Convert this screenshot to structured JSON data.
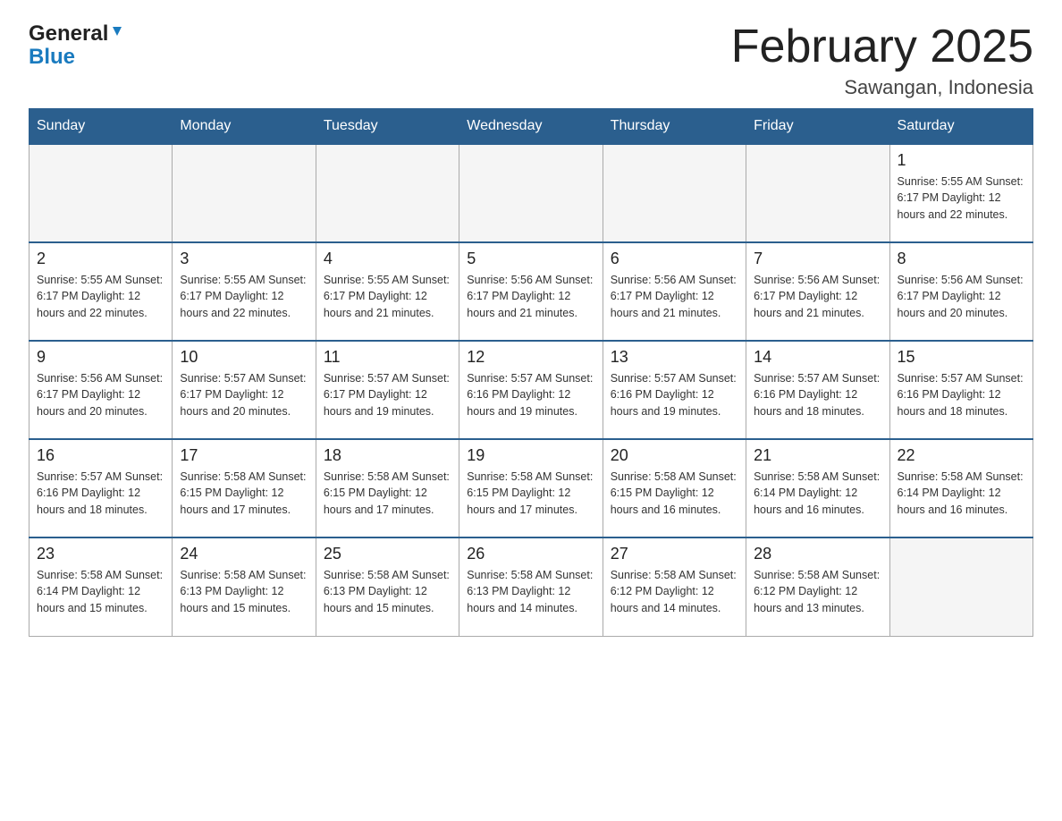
{
  "logo": {
    "general": "General",
    "blue": "Blue"
  },
  "header": {
    "month_title": "February 2025",
    "location": "Sawangan, Indonesia"
  },
  "weekdays": [
    "Sunday",
    "Monday",
    "Tuesday",
    "Wednesday",
    "Thursday",
    "Friday",
    "Saturday"
  ],
  "weeks": [
    {
      "days": [
        {
          "number": "",
          "info": "",
          "empty": true
        },
        {
          "number": "",
          "info": "",
          "empty": true
        },
        {
          "number": "",
          "info": "",
          "empty": true
        },
        {
          "number": "",
          "info": "",
          "empty": true
        },
        {
          "number": "",
          "info": "",
          "empty": true
        },
        {
          "number": "",
          "info": "",
          "empty": true
        },
        {
          "number": "1",
          "info": "Sunrise: 5:55 AM\nSunset: 6:17 PM\nDaylight: 12 hours\nand 22 minutes.",
          "empty": false
        }
      ]
    },
    {
      "days": [
        {
          "number": "2",
          "info": "Sunrise: 5:55 AM\nSunset: 6:17 PM\nDaylight: 12 hours\nand 22 minutes.",
          "empty": false
        },
        {
          "number": "3",
          "info": "Sunrise: 5:55 AM\nSunset: 6:17 PM\nDaylight: 12 hours\nand 22 minutes.",
          "empty": false
        },
        {
          "number": "4",
          "info": "Sunrise: 5:55 AM\nSunset: 6:17 PM\nDaylight: 12 hours\nand 21 minutes.",
          "empty": false
        },
        {
          "number": "5",
          "info": "Sunrise: 5:56 AM\nSunset: 6:17 PM\nDaylight: 12 hours\nand 21 minutes.",
          "empty": false
        },
        {
          "number": "6",
          "info": "Sunrise: 5:56 AM\nSunset: 6:17 PM\nDaylight: 12 hours\nand 21 minutes.",
          "empty": false
        },
        {
          "number": "7",
          "info": "Sunrise: 5:56 AM\nSunset: 6:17 PM\nDaylight: 12 hours\nand 21 minutes.",
          "empty": false
        },
        {
          "number": "8",
          "info": "Sunrise: 5:56 AM\nSunset: 6:17 PM\nDaylight: 12 hours\nand 20 minutes.",
          "empty": false
        }
      ]
    },
    {
      "days": [
        {
          "number": "9",
          "info": "Sunrise: 5:56 AM\nSunset: 6:17 PM\nDaylight: 12 hours\nand 20 minutes.",
          "empty": false
        },
        {
          "number": "10",
          "info": "Sunrise: 5:57 AM\nSunset: 6:17 PM\nDaylight: 12 hours\nand 20 minutes.",
          "empty": false
        },
        {
          "number": "11",
          "info": "Sunrise: 5:57 AM\nSunset: 6:17 PM\nDaylight: 12 hours\nand 19 minutes.",
          "empty": false
        },
        {
          "number": "12",
          "info": "Sunrise: 5:57 AM\nSunset: 6:16 PM\nDaylight: 12 hours\nand 19 minutes.",
          "empty": false
        },
        {
          "number": "13",
          "info": "Sunrise: 5:57 AM\nSunset: 6:16 PM\nDaylight: 12 hours\nand 19 minutes.",
          "empty": false
        },
        {
          "number": "14",
          "info": "Sunrise: 5:57 AM\nSunset: 6:16 PM\nDaylight: 12 hours\nand 18 minutes.",
          "empty": false
        },
        {
          "number": "15",
          "info": "Sunrise: 5:57 AM\nSunset: 6:16 PM\nDaylight: 12 hours\nand 18 minutes.",
          "empty": false
        }
      ]
    },
    {
      "days": [
        {
          "number": "16",
          "info": "Sunrise: 5:57 AM\nSunset: 6:16 PM\nDaylight: 12 hours\nand 18 minutes.",
          "empty": false
        },
        {
          "number": "17",
          "info": "Sunrise: 5:58 AM\nSunset: 6:15 PM\nDaylight: 12 hours\nand 17 minutes.",
          "empty": false
        },
        {
          "number": "18",
          "info": "Sunrise: 5:58 AM\nSunset: 6:15 PM\nDaylight: 12 hours\nand 17 minutes.",
          "empty": false
        },
        {
          "number": "19",
          "info": "Sunrise: 5:58 AM\nSunset: 6:15 PM\nDaylight: 12 hours\nand 17 minutes.",
          "empty": false
        },
        {
          "number": "20",
          "info": "Sunrise: 5:58 AM\nSunset: 6:15 PM\nDaylight: 12 hours\nand 16 minutes.",
          "empty": false
        },
        {
          "number": "21",
          "info": "Sunrise: 5:58 AM\nSunset: 6:14 PM\nDaylight: 12 hours\nand 16 minutes.",
          "empty": false
        },
        {
          "number": "22",
          "info": "Sunrise: 5:58 AM\nSunset: 6:14 PM\nDaylight: 12 hours\nand 16 minutes.",
          "empty": false
        }
      ]
    },
    {
      "days": [
        {
          "number": "23",
          "info": "Sunrise: 5:58 AM\nSunset: 6:14 PM\nDaylight: 12 hours\nand 15 minutes.",
          "empty": false
        },
        {
          "number": "24",
          "info": "Sunrise: 5:58 AM\nSunset: 6:13 PM\nDaylight: 12 hours\nand 15 minutes.",
          "empty": false
        },
        {
          "number": "25",
          "info": "Sunrise: 5:58 AM\nSunset: 6:13 PM\nDaylight: 12 hours\nand 15 minutes.",
          "empty": false
        },
        {
          "number": "26",
          "info": "Sunrise: 5:58 AM\nSunset: 6:13 PM\nDaylight: 12 hours\nand 14 minutes.",
          "empty": false
        },
        {
          "number": "27",
          "info": "Sunrise: 5:58 AM\nSunset: 6:12 PM\nDaylight: 12 hours\nand 14 minutes.",
          "empty": false
        },
        {
          "number": "28",
          "info": "Sunrise: 5:58 AM\nSunset: 6:12 PM\nDaylight: 12 hours\nand 13 minutes.",
          "empty": false
        },
        {
          "number": "",
          "info": "",
          "empty": true
        }
      ]
    }
  ]
}
